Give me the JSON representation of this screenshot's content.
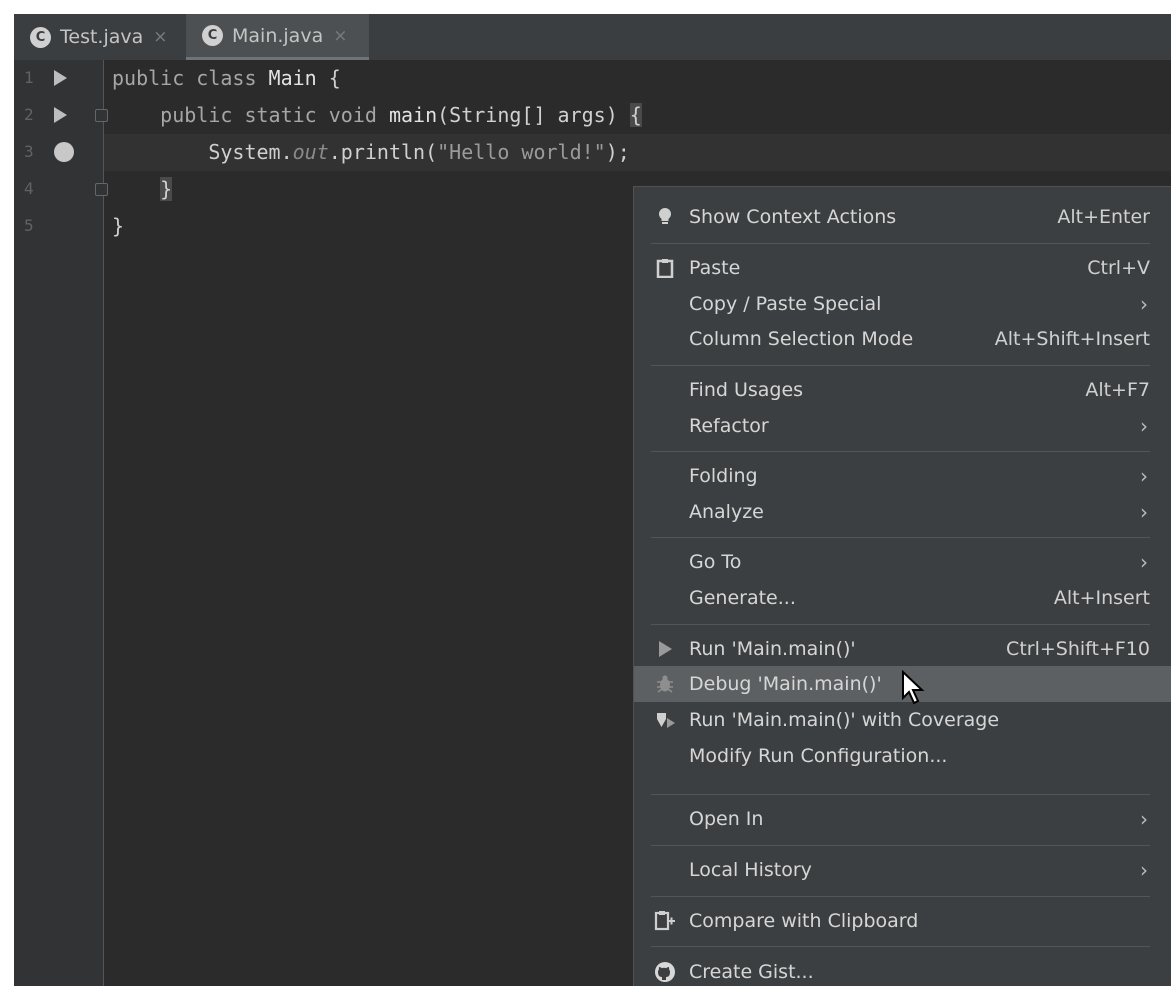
{
  "tabs": [
    {
      "icon": "C",
      "label": "Test.java",
      "close": "×"
    },
    {
      "icon": "C",
      "label": "Main.java",
      "close": "×"
    }
  ],
  "gutter": {
    "line_numbers": [
      "1",
      "2",
      "3",
      "4",
      "5"
    ]
  },
  "code": {
    "line1": {
      "kw": "public class ",
      "name": "Main",
      "rest": " {"
    },
    "line2": {
      "kw": "public static void ",
      "name": "main",
      "rest": "(String[] args) ",
      "brace": "{"
    },
    "line3": {
      "a": "System.",
      "b": "out",
      "c": ".println(",
      "d": "\"Hello world!\"",
      "e": ");"
    },
    "line4": {
      "brace": "}"
    },
    "line5": {
      "brace": "}"
    }
  },
  "menu": {
    "items": [
      {
        "label": "Show Context Actions",
        "shortcut": "Alt+Enter",
        "icon": "lightbulb-icon"
      },
      {
        "label": "Paste",
        "shortcut": "Ctrl+V",
        "icon": "clipboard-icon"
      },
      {
        "label": "Copy / Paste Special",
        "arrow": "›"
      },
      {
        "label": "Column Selection Mode",
        "shortcut": "Alt+Shift+Insert"
      },
      {
        "label": "Find Usages",
        "shortcut": "Alt+F7"
      },
      {
        "label": "Refactor",
        "arrow": "›"
      },
      {
        "label": "Folding",
        "arrow": "›"
      },
      {
        "label": "Analyze",
        "arrow": "›"
      },
      {
        "label": "Go To",
        "arrow": "›"
      },
      {
        "label": "Generate...",
        "shortcut": "Alt+Insert"
      },
      {
        "label": "Run 'Main.main()'",
        "shortcut": "Ctrl+Shift+F10",
        "icon": "run-icon"
      },
      {
        "label": "Debug 'Main.main()'",
        "icon": "debug-bug-icon"
      },
      {
        "label": "Run 'Main.main()' with Coverage",
        "icon": "coverage-icon"
      },
      {
        "label": "Modify Run Configuration..."
      },
      {
        "label": "Open In",
        "arrow": "›"
      },
      {
        "label": "Local History",
        "arrow": "›"
      },
      {
        "label": "Compare with Clipboard",
        "icon": "compare-clipboard-icon"
      },
      {
        "label": "Create Gist...",
        "icon": "github-icon"
      }
    ]
  }
}
